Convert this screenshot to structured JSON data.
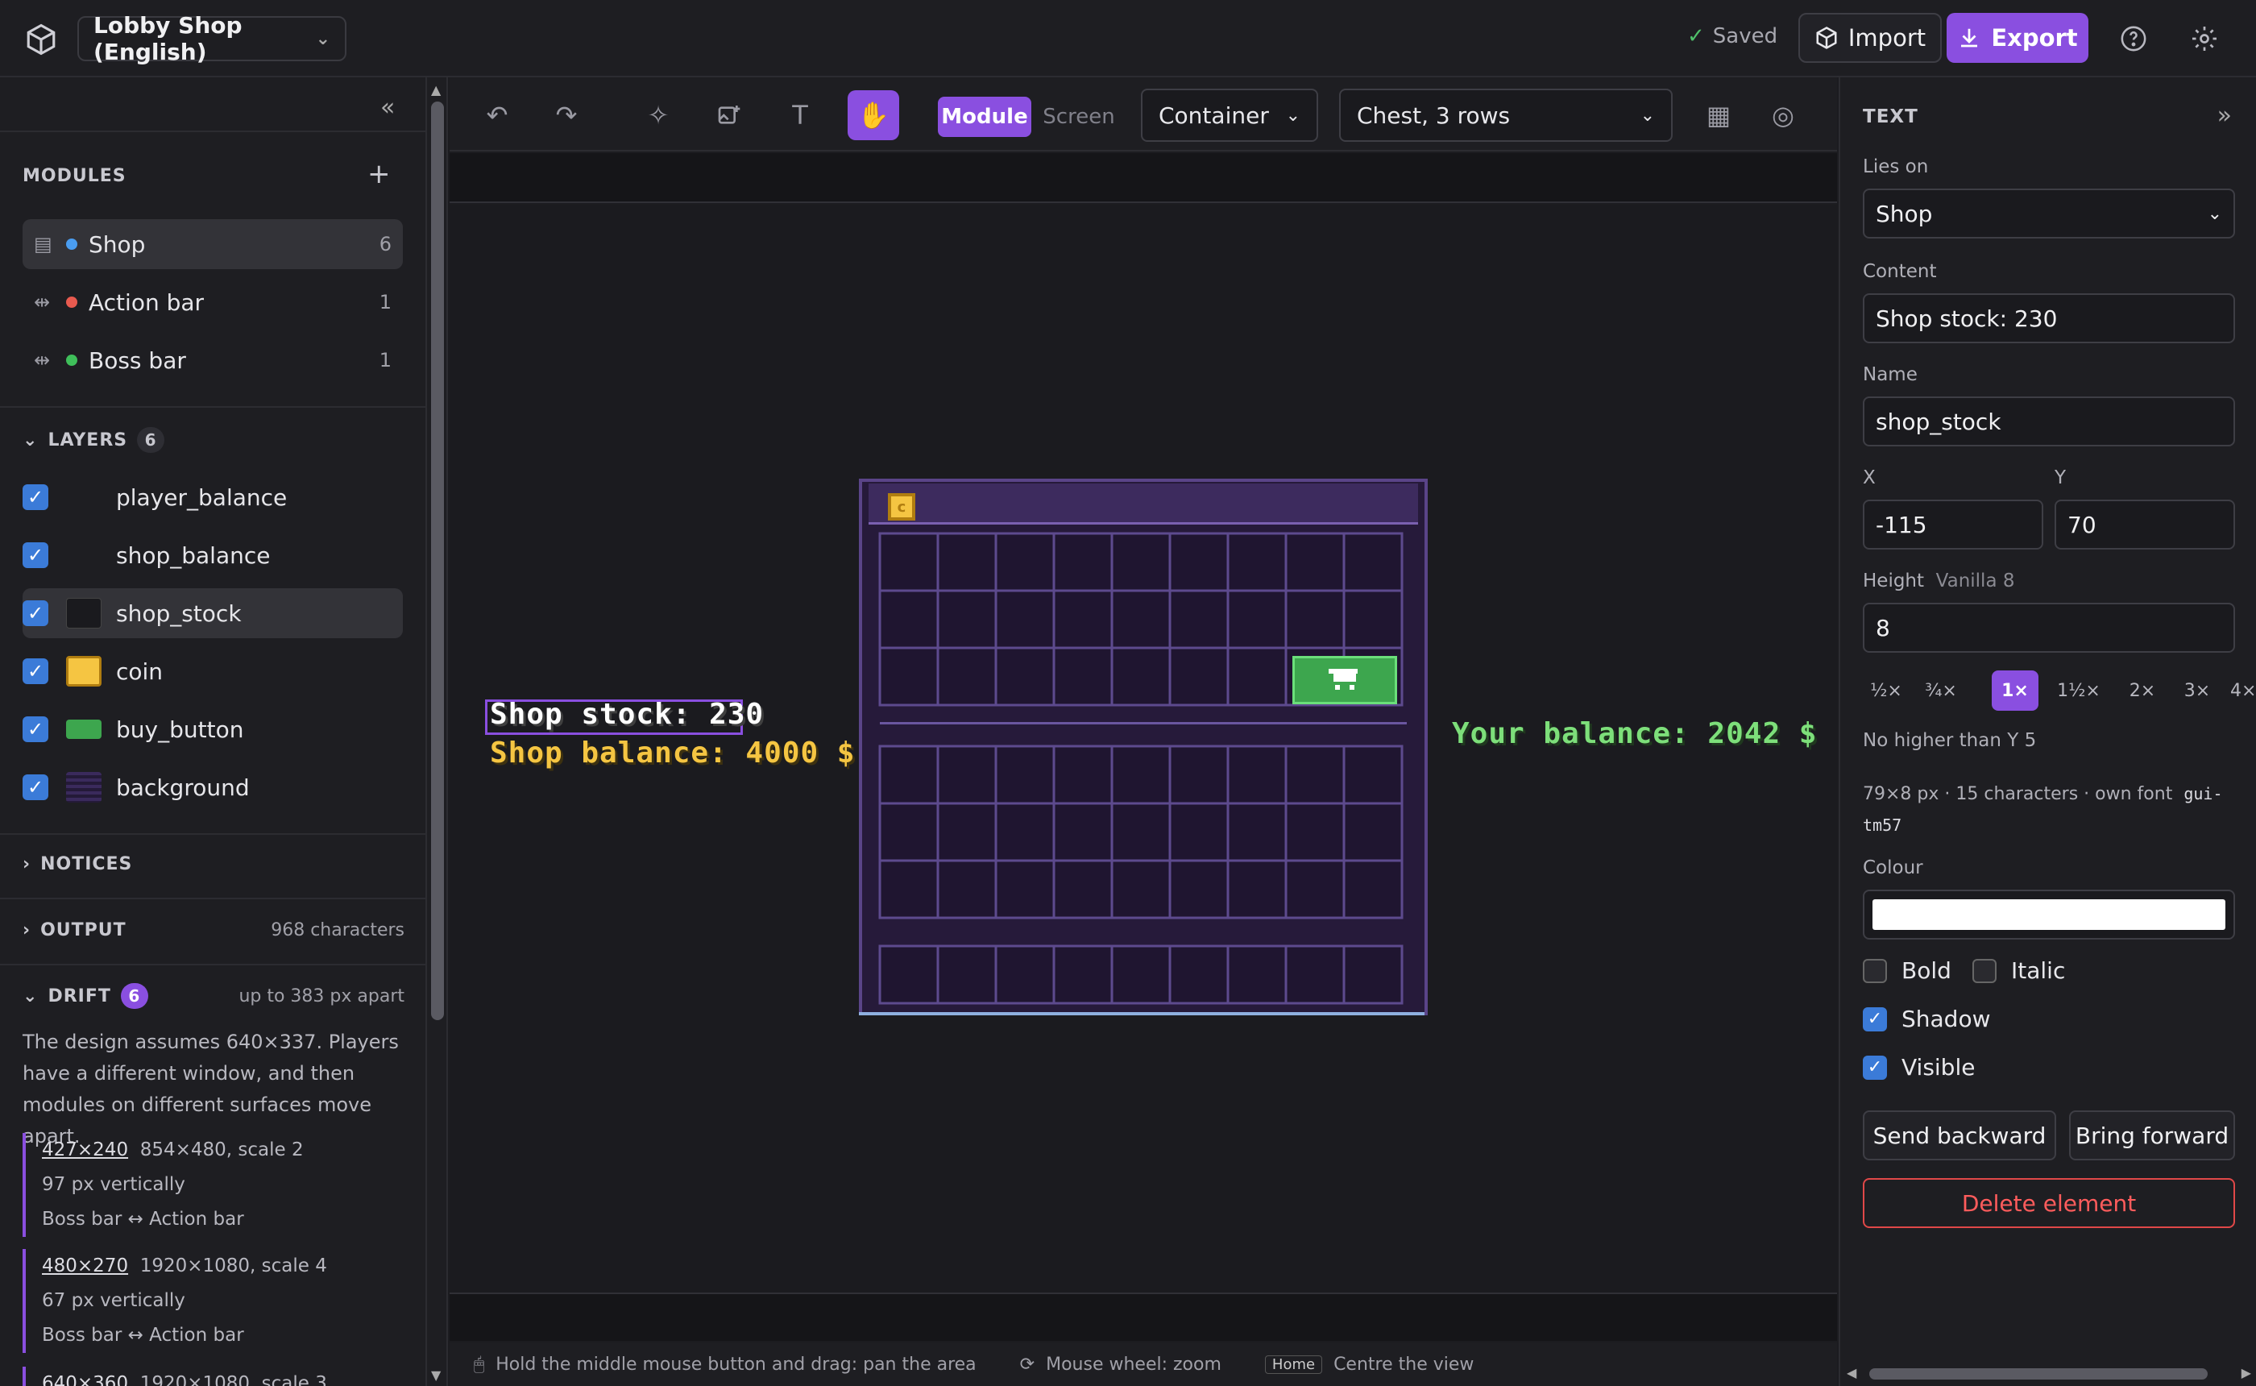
{
  "header": {
    "project": "Lobby Shop (English)",
    "saved": "Saved",
    "import_label": "Import",
    "export_label": "Export"
  },
  "sidebar": {
    "modules_title": "MODULES",
    "modules": [
      {
        "name": "Shop",
        "count": "6",
        "color": "#4a9df0"
      },
      {
        "name": "Action bar",
        "count": "1",
        "color": "#e85a4f"
      },
      {
        "name": "Boss bar",
        "count": "1",
        "color": "#3fbf5a"
      }
    ],
    "layers_title": "LAYERS",
    "layers_count": "6",
    "layers": [
      {
        "name": "player_balance"
      },
      {
        "name": "shop_balance"
      },
      {
        "name": "shop_stock"
      },
      {
        "name": "coin"
      },
      {
        "name": "buy_button"
      },
      {
        "name": "background"
      }
    ],
    "notices_title": "NOTICES",
    "output_title": "OUTPUT",
    "output_value": "968 characters",
    "drift_title": "DRIFT",
    "drift_count": "6",
    "drift_sub": "up to 383 px apart",
    "drift_text": "The design assumes 640×337. Players have a different window, and then modules on different surfaces move apart.",
    "drift_items": [
      {
        "res": "427×240",
        "detail": "854×480, scale 2",
        "dist": "97 px vertically",
        "pair": "Boss bar ↔ Action bar"
      },
      {
        "res": "480×270",
        "detail": "1920×1080, scale 4",
        "dist": "67 px vertically",
        "pair": "Boss bar ↔ Action bar"
      },
      {
        "res": "640×360",
        "detail": "1920×1080, scale 3",
        "dist": "",
        "pair": ""
      }
    ]
  },
  "toolbar": {
    "mode_module": "Module",
    "mode_screen": "Screen",
    "container": "Container",
    "layout": "Chest, 3 rows"
  },
  "canvas": {
    "shop_stock": "Shop stock: 230",
    "shop_balance": "Shop balance: 4000 $",
    "player_balance": "Your balance: 2042 $",
    "coin_glyph": "c"
  },
  "status": {
    "pan": "Hold the middle mouse button and drag: pan the area",
    "zoom": "Mouse wheel: zoom",
    "home_key": "Home",
    "home": "Centre the view"
  },
  "panel": {
    "title": "TEXT",
    "lies_on_label": "Lies on",
    "lies_on": "Shop",
    "content_label": "Content",
    "content": "Shop stock: 230",
    "name_label": "Name",
    "name": "shop_stock",
    "x_label": "X",
    "x": "-115",
    "y_label": "Y",
    "y": "70",
    "height_label": "Height",
    "height_hint": "Vanilla 8",
    "height": "8",
    "multipliers": [
      "½×",
      "¾×",
      "1×",
      "1½×",
      "2×",
      "3×",
      "4×"
    ],
    "limit": "No higher than Y 5",
    "info": "79×8 px · 15 characters · own font",
    "font_code": "gui-tm57",
    "colour_label": "Colour",
    "colour": "#ffffff",
    "bold": "Bold",
    "italic": "Italic",
    "shadow": "Shadow",
    "visible": "Visible",
    "send_backward": "Send backward",
    "bring_forward": "Bring forward",
    "delete": "Delete element"
  },
  "colors": {
    "accent": "#8a4fe0",
    "gold": "#f5c542",
    "green": "#7ddf7a",
    "danger": "#e04848"
  }
}
